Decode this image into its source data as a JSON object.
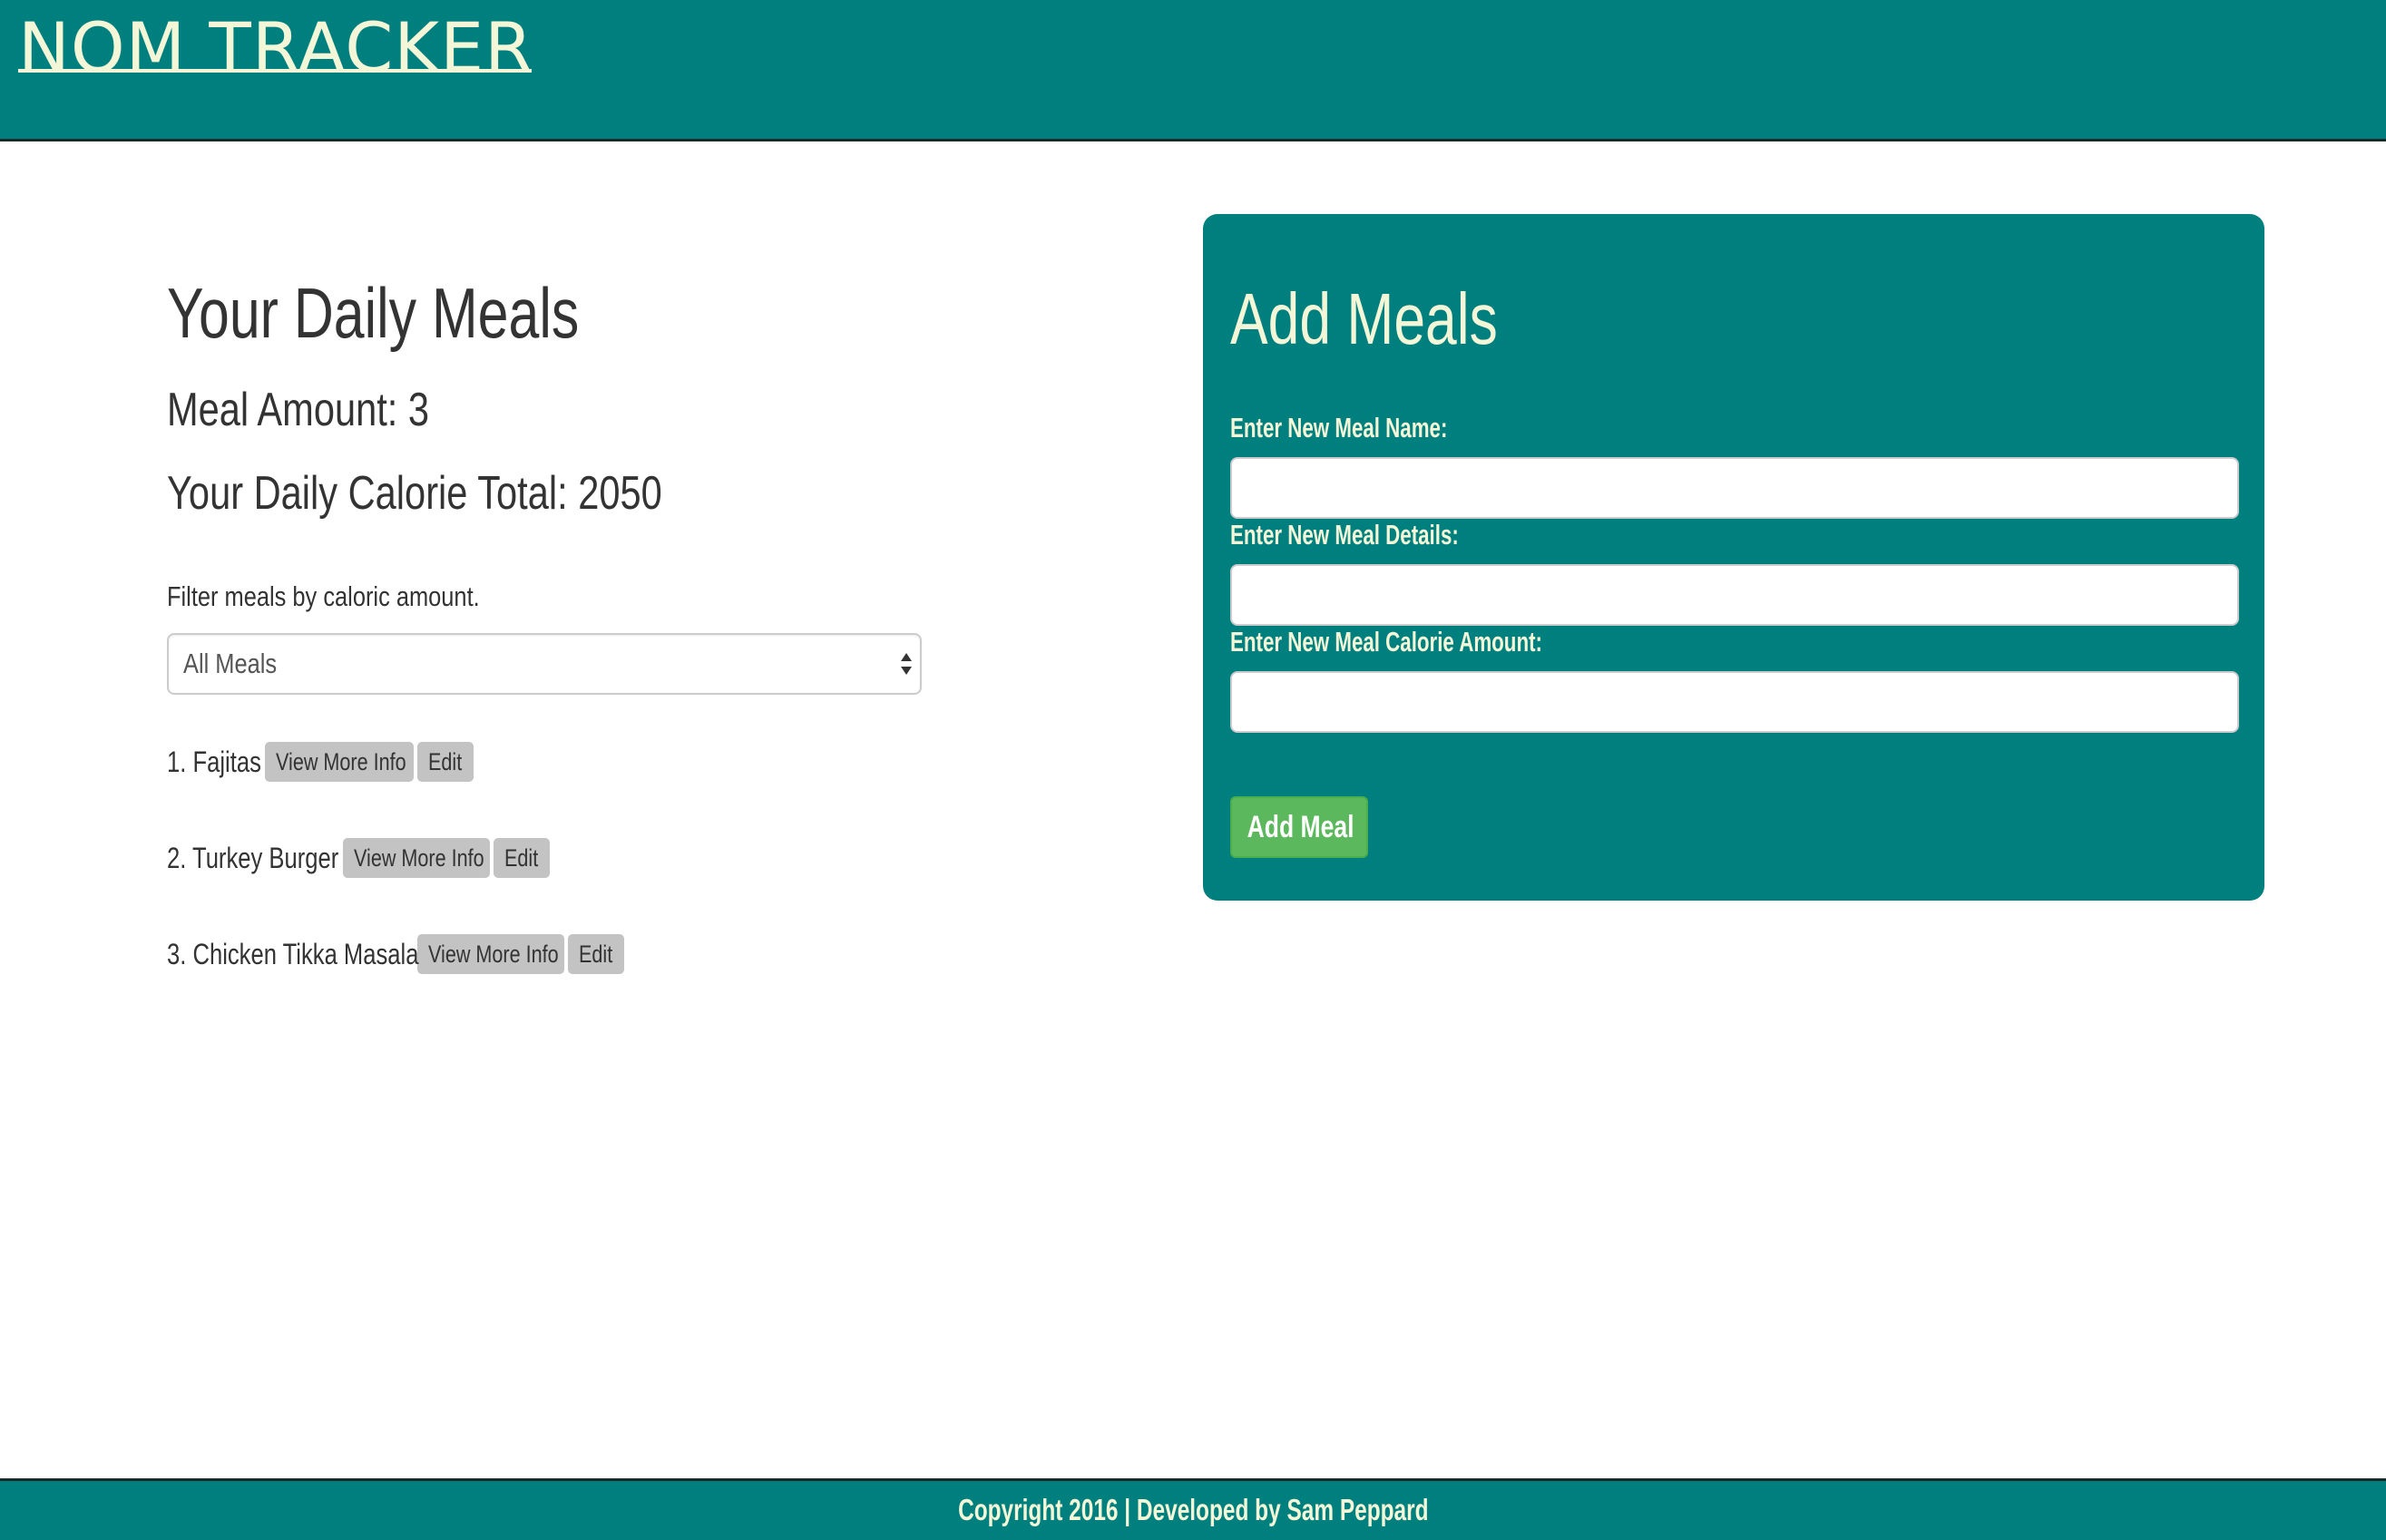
{
  "header": {
    "logo_text": "NOM TRACKER"
  },
  "meals_section": {
    "title": "Your Daily Meals",
    "meal_amount": "Meal Amount: 3",
    "calorie_total": "Your Daily Calorie Total: 2050",
    "filter_label": "Filter meals by caloric amount.",
    "filter_selected": "All Meals",
    "meals": [
      {
        "name": "1. Fajitas",
        "info_label": "View More Info",
        "edit_label": "Edit"
      },
      {
        "name": "2. Turkey Burger",
        "info_label": "View More Info",
        "edit_label": "Edit"
      },
      {
        "name": "3. Chicken Tikka Masala",
        "info_label": "View More Info",
        "edit_label": "Edit"
      }
    ]
  },
  "add_panel": {
    "title": "Add Meals",
    "name_label": "Enter New Meal Name:",
    "name_value": "",
    "details_label": "Enter New Meal Details:",
    "details_value": "",
    "calorie_label": "Enter New Meal Calorie Amount:",
    "calorie_value": "",
    "submit_label": "Add Meal"
  },
  "footer": {
    "text": "Copyright 2016 | Developed by Sam Peppard"
  },
  "colors": {
    "primary": "#007f7f",
    "accent_text": "#f3f7d8",
    "success": "#5cb85c",
    "button_gray": "#c3c3c3",
    "text_dark": "#333333"
  },
  "icons": {
    "select_arrows": "updown-chevron-icon"
  }
}
